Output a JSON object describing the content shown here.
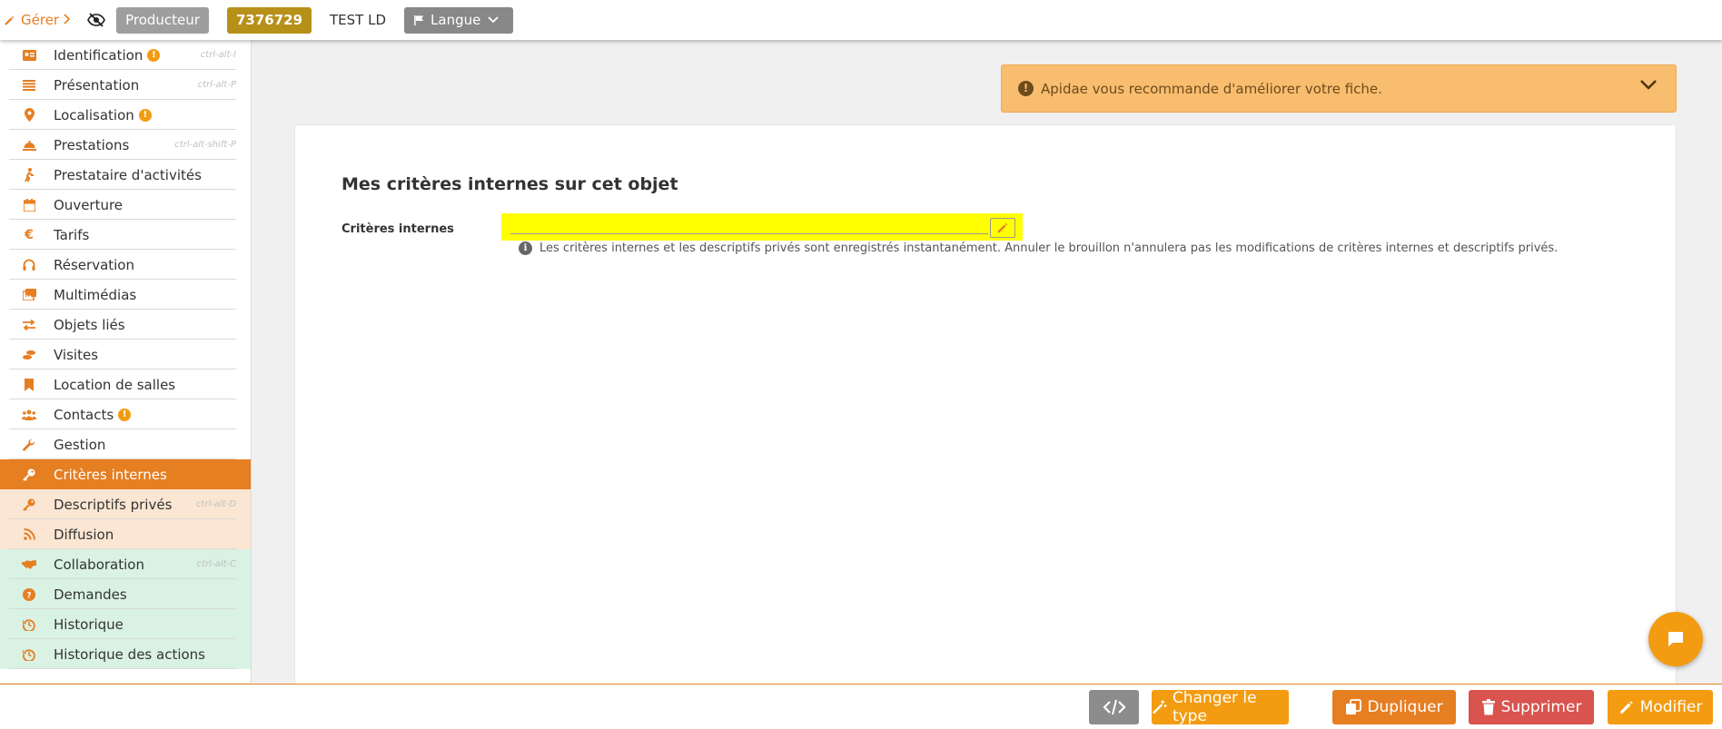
{
  "topbar": {
    "manage_label": "Gérer",
    "producer_label": "Producteur",
    "object_id": "7376729",
    "object_name": "TEST LD",
    "language_label": "Langue"
  },
  "sidebar": {
    "items": [
      {
        "label": "Identification",
        "icon": "id-card-icon",
        "shortcut": "ctrl-alt-I",
        "warning": true
      },
      {
        "label": "Présentation",
        "icon": "list-icon",
        "shortcut": "ctrl-alt-P",
        "warning": false
      },
      {
        "label": "Localisation",
        "icon": "map-marker-icon",
        "shortcut": "",
        "warning": true
      },
      {
        "label": "Prestations",
        "icon": "concierge-bell-icon",
        "shortcut": "ctrl-alt-shift-P",
        "warning": false
      },
      {
        "label": "Prestataire d'activités",
        "icon": "hiking-icon",
        "shortcut": "",
        "warning": false
      },
      {
        "label": "Ouverture",
        "icon": "calendar-icon",
        "shortcut": "",
        "warning": false
      },
      {
        "label": "Tarifs",
        "icon": "euro-icon",
        "shortcut": "",
        "warning": false
      },
      {
        "label": "Réservation",
        "icon": "headset-icon",
        "shortcut": "",
        "warning": false
      },
      {
        "label": "Multimédias",
        "icon": "images-icon",
        "shortcut": "",
        "warning": false
      },
      {
        "label": "Objets liés",
        "icon": "exchange-icon",
        "shortcut": "",
        "warning": false
      },
      {
        "label": "Visites",
        "icon": "shoe-prints-icon",
        "shortcut": "",
        "warning": false
      },
      {
        "label": "Location de salles",
        "icon": "bookmark-icon",
        "shortcut": "",
        "warning": false
      },
      {
        "label": "Contacts",
        "icon": "users-icon",
        "shortcut": "",
        "warning": true
      },
      {
        "label": "Gestion",
        "icon": "wrench-icon",
        "shortcut": "",
        "warning": false
      },
      {
        "label": "Critères internes",
        "icon": "key-icon",
        "shortcut": "",
        "warning": false,
        "state": "active"
      },
      {
        "label": "Descriptifs privés",
        "icon": "key-icon",
        "shortcut": "ctrl-alt-D",
        "warning": false,
        "state": "peach"
      },
      {
        "label": "Diffusion",
        "icon": "rss-icon",
        "shortcut": "",
        "warning": false,
        "state": "peach"
      },
      {
        "label": "Collaboration",
        "icon": "handshake-icon",
        "shortcut": "ctrl-alt-C",
        "warning": false,
        "state": "green"
      },
      {
        "label": "Demandes",
        "icon": "question-circle-icon",
        "shortcut": "",
        "warning": false,
        "state": "green"
      },
      {
        "label": "Historique",
        "icon": "history-icon",
        "shortcut": "",
        "warning": false,
        "state": "green"
      },
      {
        "label": "Historique des actions",
        "icon": "history-icon",
        "shortcut": "",
        "warning": false,
        "state": "green"
      }
    ]
  },
  "alert": {
    "text": "Apidae vous recommande d'améliorer votre fiche."
  },
  "main": {
    "title": "Mes critères internes sur cet objet",
    "field_label": "Critères internes",
    "info_text": "Les critères internes et les descriptifs privés sont enregistrés instantanément. Annuler le brouillon n'annulera pas les modifications de critères internes et descriptifs privés."
  },
  "footer": {
    "change_type_label": "Changer le type",
    "duplicate_label": "Dupliquer",
    "delete_label": "Supprimer",
    "edit_label": "Modifier"
  },
  "colors": {
    "accent": "#e67e22",
    "gold": "#b7901a",
    "danger": "#d9534f",
    "highlight": "#ffff00"
  }
}
